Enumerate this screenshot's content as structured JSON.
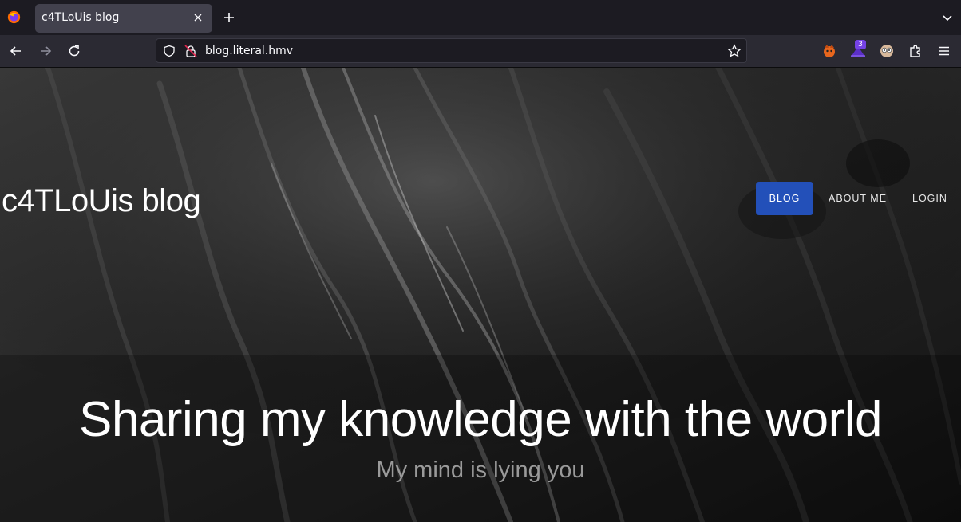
{
  "browser": {
    "tab_title": "c4TLoUis blog",
    "url": "blog.literal.hmv",
    "extension_badge": "3"
  },
  "site": {
    "title": "c4TLoUis blog",
    "menu": {
      "blog": "BLOG",
      "about": "ABOUT ME",
      "login": "LOGIN"
    }
  },
  "hero": {
    "heading": "Sharing my knowledge with the world",
    "subheading": "My mind is lying you"
  },
  "colors": {
    "accent": "#2350b9",
    "chrome_bg": "#1c1b22",
    "toolbar_bg": "#2b2a33"
  }
}
